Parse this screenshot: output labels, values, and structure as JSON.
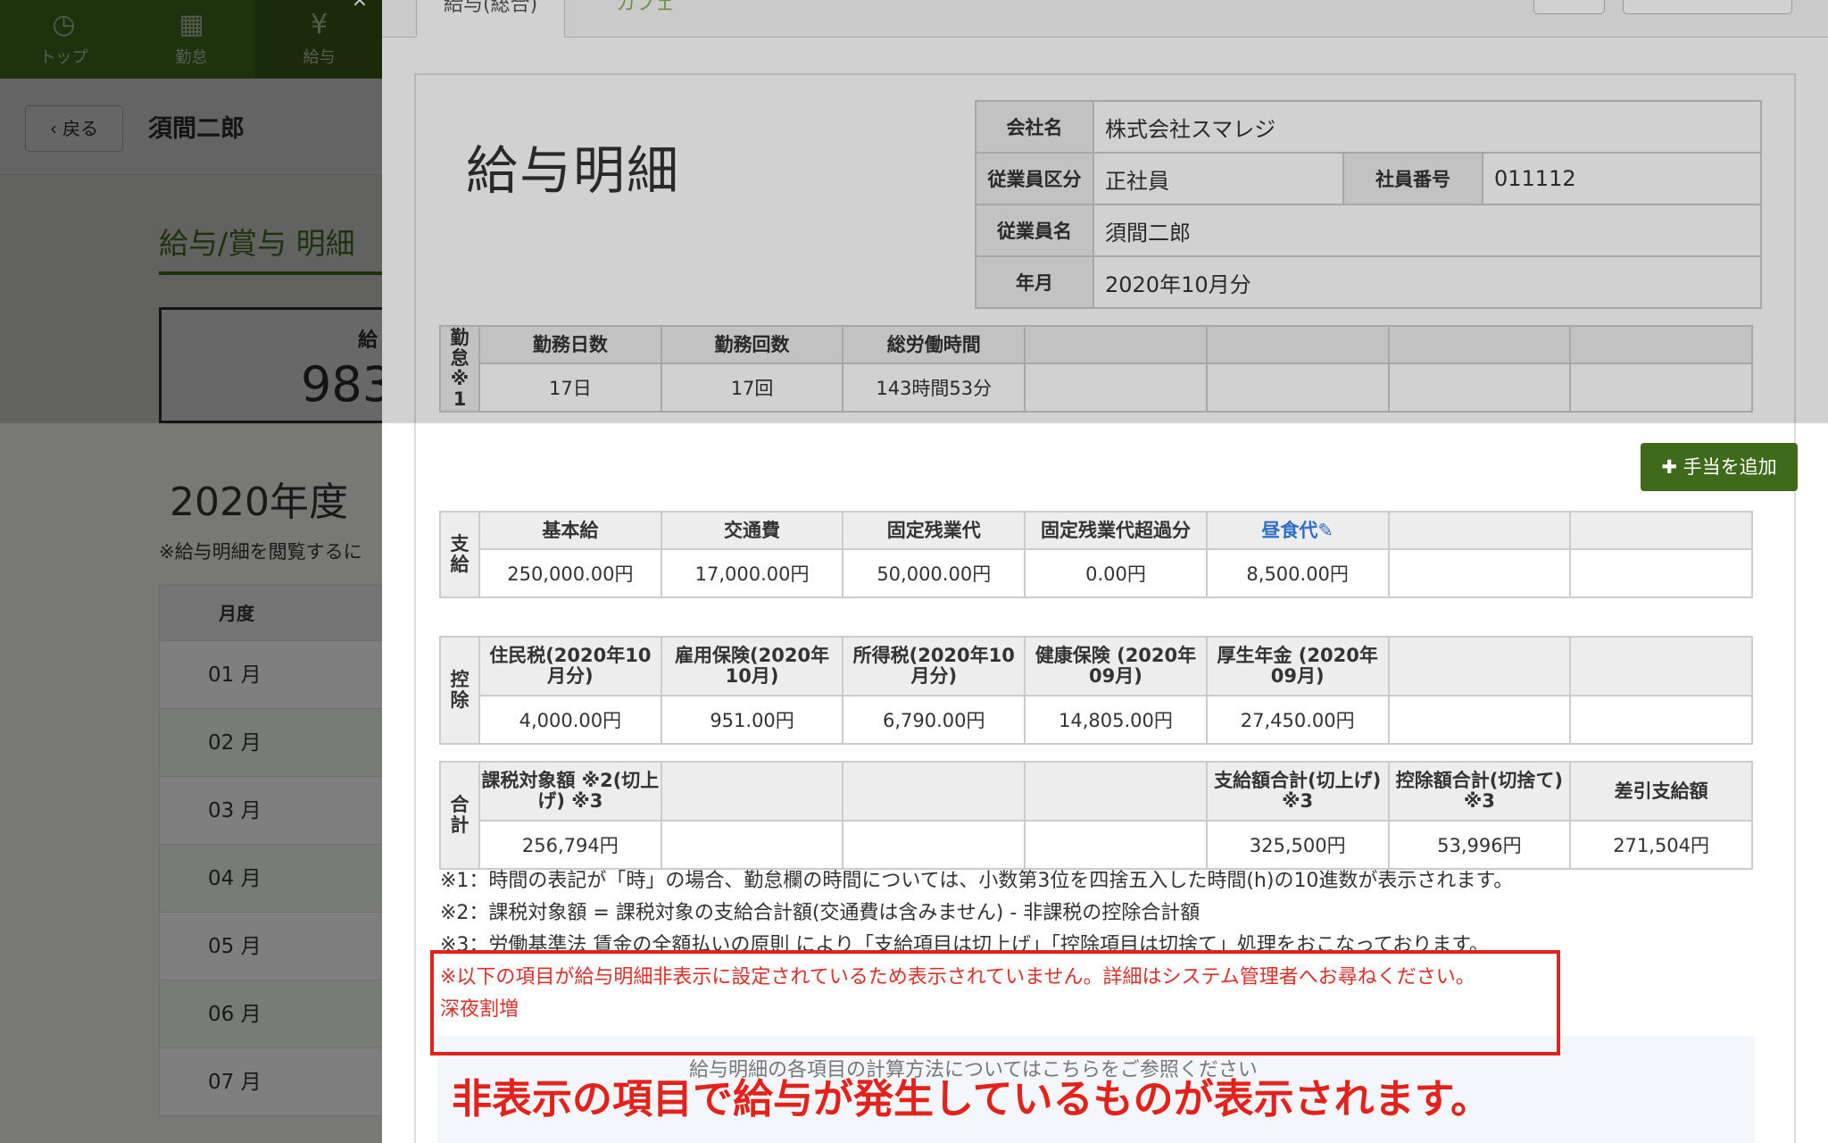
{
  "nav": {
    "items": [
      {
        "label": "トップ",
        "icon": "clock-icon"
      },
      {
        "label": "勤怠",
        "icon": "calendar-icon"
      },
      {
        "label": "給与",
        "icon": "money-icon"
      }
    ]
  },
  "subbar": {
    "back_label": "戻る",
    "employee": "須間二郎"
  },
  "background": {
    "section_title": "給与/賞与 明細",
    "summary_label": "給",
    "summary_value": "983",
    "year_label": "2020年度",
    "note": "※給与明細を閲覧するに",
    "month_header": "月度",
    "months": [
      "01 月",
      "02 月",
      "03 月",
      "04 月",
      "05 月",
      "06 月",
      "07 月"
    ]
  },
  "modal": {
    "tabs": [
      "給与(総合)",
      "カフェ"
    ],
    "title": "給与明細",
    "info": {
      "company_label": "会社名",
      "company": "株式会社スマレジ",
      "type_label": "従業員区分",
      "type": "正社員",
      "id_label": "社員番号",
      "id": "011112",
      "name_label": "従業員名",
      "name": "須間二郎",
      "period_label": "年月",
      "period": "2020年10月分"
    },
    "attendance": {
      "side": "勤\n怠\n※\n1",
      "headers": [
        "勤務日数",
        "勤務回数",
        "総労働時間",
        "",
        "",
        "",
        ""
      ],
      "values": [
        "17日",
        "17回",
        "143時間53分",
        "",
        "",
        "",
        ""
      ]
    },
    "add_button": "手当を追加",
    "payment": {
      "side": "支\n給",
      "headers": [
        "基本給",
        "交通費",
        "固定残業代",
        "固定残業代超過分",
        "昼食代",
        "",
        ""
      ],
      "values": [
        "250,000.00円",
        "17,000.00円",
        "50,000.00円",
        "0.00円",
        "8,500.00円",
        "",
        ""
      ]
    },
    "deduction": {
      "side": "控\n除",
      "headers": [
        "住民税(2020年10月分)",
        "雇用保険(2020年10月)",
        "所得税(2020年10月分)",
        "健康保険 (2020年09月)",
        "厚生年金 (2020年09月)",
        "",
        ""
      ],
      "values": [
        "4,000.00円",
        "951.00円",
        "6,790.00円",
        "14,805.00円",
        "27,450.00円",
        "",
        ""
      ]
    },
    "total": {
      "side": "合\n計",
      "headers": [
        "課税対象額 ※2(切上げ) ※3",
        "",
        "",
        "",
        "支給額合計(切上げ) ※3",
        "控除額合計(切捨て) ※3",
        "差引支給額"
      ],
      "values": [
        "256,794円",
        "",
        "",
        "",
        "325,500円",
        "53,996円",
        "271,504円"
      ]
    },
    "notes": [
      "※1：時間の表記が「時」の場合、勤怠欄の時間については、小数第3位を四捨五入した時間(h)の10進数が表示されます。",
      "※2：課税対象額 = 課税対象の支給合計額(交通費は含みません) - 非課税の控除合計額",
      "※3：労働基準法 賃金の全額払いの原則 により「支給項目は切上げ」「控除項目は切捨て」処理をおこなっております。"
    ],
    "hidden_note": "※以下の項目が給与明細非表示に設定されているため表示されていません。詳細はシステム管理者へお尋ねください。",
    "hidden_item": "深夜割増",
    "footer_text": "給与明細の各項目の計算方法についてはこちらをご参照ください"
  },
  "callout": "非表示の項目で給与が発生しているものが表示されます。"
}
